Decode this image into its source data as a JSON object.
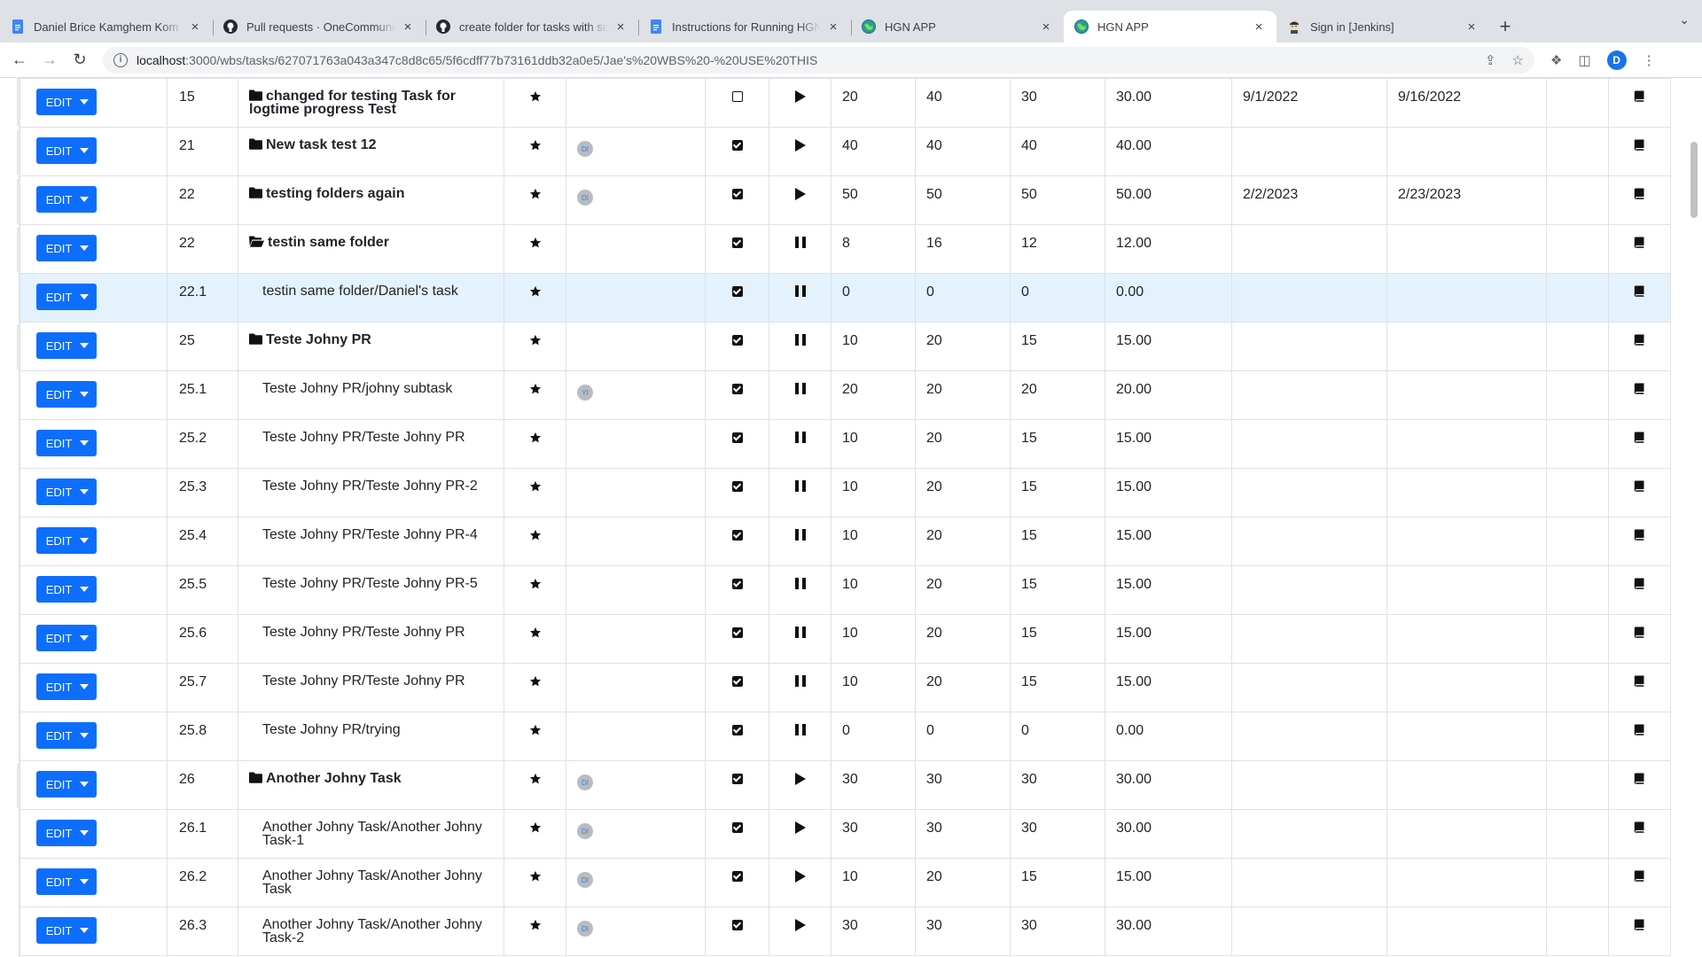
{
  "browser": {
    "tabs": [
      {
        "title": "Daniel Brice Kamghem Kom and",
        "icon": "google-docs-icon",
        "active": false
      },
      {
        "title": "Pull requests · OneCommunityGlobal",
        "icon": "github-icon",
        "active": false
      },
      {
        "title": "create folder for tasks with subtasks",
        "icon": "github-icon",
        "active": false
      },
      {
        "title": "Instructions for Running HGN Project",
        "icon": "google-docs-icon",
        "active": false
      },
      {
        "title": "HGN APP",
        "icon": "hgn-globe-icon",
        "active": false
      },
      {
        "title": "HGN APP",
        "icon": "hgn-globe-icon",
        "active": true
      },
      {
        "title": "Sign in [Jenkins]",
        "icon": "jenkins-icon",
        "active": false
      }
    ],
    "url_host": "localhost",
    "url_path": ":3000/wbs/tasks/627071763a043a347c8d8c65/5f6cdff77b73161ddb32a0e5/Jae's%20WBS%20-%20USE%20THIS",
    "profile_initial": "D"
  },
  "task_table": {
    "edit_label": "EDIT",
    "rows": [
      {
        "num": "",
        "name": "",
        "kind": "stub"
      },
      {
        "num": "15",
        "name": "changed for testing Task for logtime progress Test",
        "kind": "folder",
        "avatar": "",
        "checked": false,
        "status": "play",
        "h1": "20",
        "h2": "40",
        "h3": "30",
        "h4": "30.00",
        "start": "9/1/2022",
        "end": "9/16/2022"
      },
      {
        "num": "21",
        "name": "New task test 12",
        "kind": "folder",
        "avatar": "DI",
        "checked": true,
        "status": "play",
        "h1": "40",
        "h2": "40",
        "h3": "40",
        "h4": "40.00",
        "start": "",
        "end": ""
      },
      {
        "num": "22",
        "name": "testing folders again",
        "kind": "folder",
        "avatar": "DI",
        "checked": true,
        "status": "play",
        "h1": "50",
        "h2": "50",
        "h3": "50",
        "h4": "50.00",
        "start": "2/2/2023",
        "end": "2/23/2023"
      },
      {
        "num": "22",
        "name": "testin same folder",
        "kind": "folder-open",
        "avatar": "",
        "checked": true,
        "status": "pause",
        "h1": "8",
        "h2": "16",
        "h3": "12",
        "h4": "12.00",
        "start": "",
        "end": ""
      },
      {
        "num": "22.1",
        "name": "testin same folder/Daniel's task",
        "kind": "sub",
        "avatar": "",
        "checked": true,
        "status": "pause",
        "h1": "0",
        "h2": "0",
        "h3": "0",
        "h4": "0.00",
        "start": "",
        "end": "",
        "highlight": true
      },
      {
        "num": "25",
        "name": "Teste Johny PR",
        "kind": "folder",
        "avatar": "",
        "checked": true,
        "status": "pause",
        "h1": "10",
        "h2": "20",
        "h3": "15",
        "h4": "15.00",
        "start": "",
        "end": ""
      },
      {
        "num": "25.1",
        "name": "Teste Johny PR/johny subtask",
        "kind": "sub",
        "avatar": "YI",
        "checked": true,
        "status": "pause",
        "h1": "20",
        "h2": "20",
        "h3": "20",
        "h4": "20.00",
        "start": "",
        "end": ""
      },
      {
        "num": "25.2",
        "name": "Teste Johny PR/Teste Johny PR",
        "kind": "sub",
        "avatar": "",
        "checked": true,
        "status": "pause",
        "h1": "10",
        "h2": "20",
        "h3": "15",
        "h4": "15.00",
        "start": "",
        "end": ""
      },
      {
        "num": "25.3",
        "name": "Teste Johny PR/Teste Johny PR-2",
        "kind": "sub",
        "avatar": "",
        "checked": true,
        "status": "pause",
        "h1": "10",
        "h2": "20",
        "h3": "15",
        "h4": "15.00",
        "start": "",
        "end": ""
      },
      {
        "num": "25.4",
        "name": "Teste Johny PR/Teste Johny PR-4",
        "kind": "sub",
        "avatar": "",
        "checked": true,
        "status": "pause",
        "h1": "10",
        "h2": "20",
        "h3": "15",
        "h4": "15.00",
        "start": "",
        "end": ""
      },
      {
        "num": "25.5",
        "name": "Teste Johny PR/Teste Johny PR-5",
        "kind": "sub",
        "avatar": "",
        "checked": true,
        "status": "pause",
        "h1": "10",
        "h2": "20",
        "h3": "15",
        "h4": "15.00",
        "start": "",
        "end": ""
      },
      {
        "num": "25.6",
        "name": "Teste Johny PR/Teste Johny PR",
        "kind": "sub",
        "avatar": "",
        "checked": true,
        "status": "pause",
        "h1": "10",
        "h2": "20",
        "h3": "15",
        "h4": "15.00",
        "start": "",
        "end": ""
      },
      {
        "num": "25.7",
        "name": "Teste Johny PR/Teste Johny PR",
        "kind": "sub",
        "avatar": "",
        "checked": true,
        "status": "pause",
        "h1": "10",
        "h2": "20",
        "h3": "15",
        "h4": "15.00",
        "start": "",
        "end": ""
      },
      {
        "num": "25.8",
        "name": "Teste Johny PR/trying",
        "kind": "sub",
        "avatar": "",
        "checked": true,
        "status": "pause",
        "h1": "0",
        "h2": "0",
        "h3": "0",
        "h4": "0.00",
        "start": "",
        "end": ""
      },
      {
        "num": "26",
        "name": "Another Johny Task",
        "kind": "folder",
        "avatar": "DI",
        "checked": true,
        "status": "play",
        "h1": "30",
        "h2": "30",
        "h3": "30",
        "h4": "30.00",
        "start": "",
        "end": ""
      },
      {
        "num": "26.1",
        "name": "Another Johny Task/Another Johny Task-1",
        "kind": "sub",
        "avatar": "DI",
        "checked": true,
        "status": "play",
        "h1": "30",
        "h2": "30",
        "h3": "30",
        "h4": "30.00",
        "start": "",
        "end": ""
      },
      {
        "num": "26.2",
        "name": "Another Johny Task/Another Johny Task",
        "kind": "sub",
        "avatar": "DI",
        "checked": true,
        "status": "play",
        "h1": "10",
        "h2": "20",
        "h3": "15",
        "h4": "15.00",
        "start": "",
        "end": ""
      },
      {
        "num": "26.3",
        "name": "Another Johny Task/Another Johny Task-2",
        "kind": "sub",
        "avatar": "DI",
        "checked": true,
        "status": "play",
        "h1": "30",
        "h2": "30",
        "h3": "30",
        "h4": "30.00",
        "start": "",
        "end": ""
      }
    ]
  },
  "colors": {
    "edit_button": "#0d6efd",
    "row_highlight": "#e4f2fd",
    "avatar_bg": "#b8bcc0",
    "avatar_text": "#2f80ed"
  }
}
